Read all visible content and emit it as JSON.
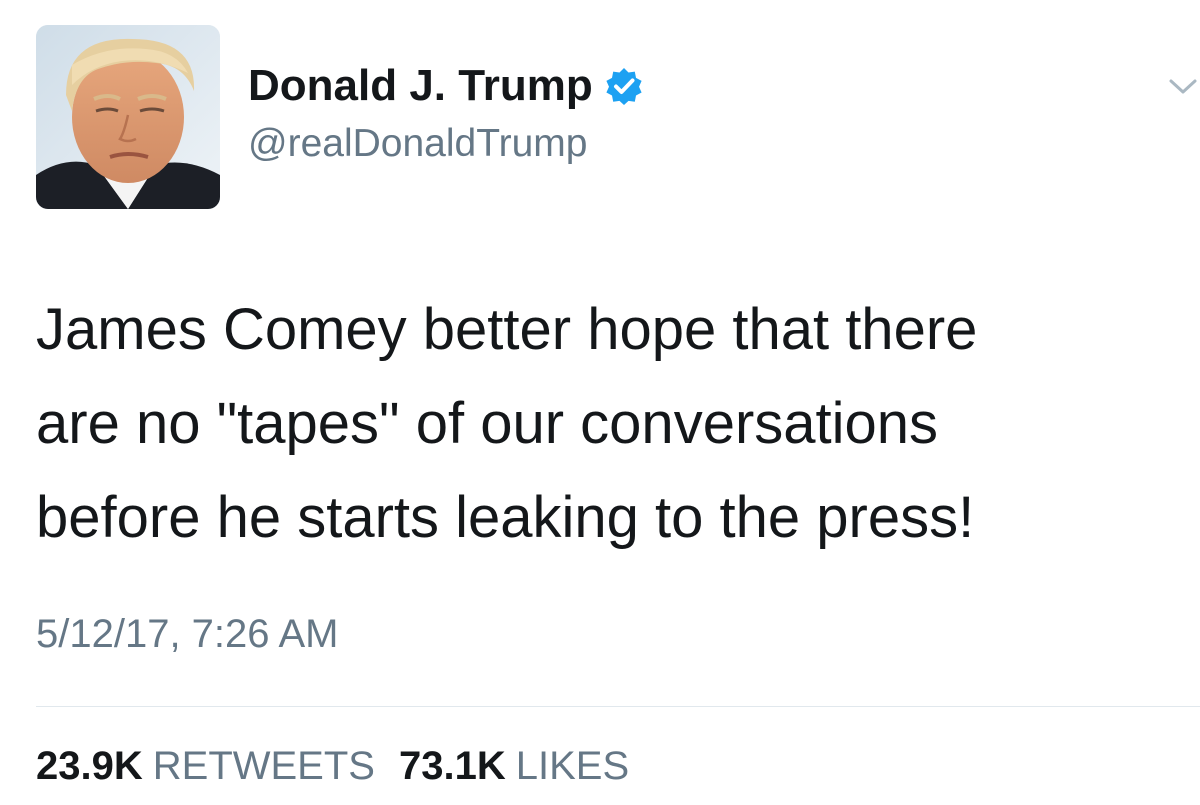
{
  "author": {
    "display_name": "Donald J. Trump",
    "handle": "@realDonaldTrump",
    "verified": true,
    "avatar": "profile-photo"
  },
  "tweet": {
    "text_lines": [
      "James Comey better hope that there",
      "are no \"tapes\" of our conversations",
      "before he starts leaking to the press!"
    ],
    "timestamp": "5/12/17, 7:26 AM"
  },
  "stats": {
    "retweets_count": "23.9K",
    "retweets_label": "RETWEETS",
    "likes_count": "73.1K",
    "likes_label": "LIKES"
  },
  "icons": {
    "verified": "verified-badge-icon",
    "menu": "chevron-down-icon"
  },
  "colors": {
    "text": "#14171a",
    "secondary": "#657786",
    "verified_blue": "#1da1f2",
    "divider": "#e1e8ed"
  }
}
